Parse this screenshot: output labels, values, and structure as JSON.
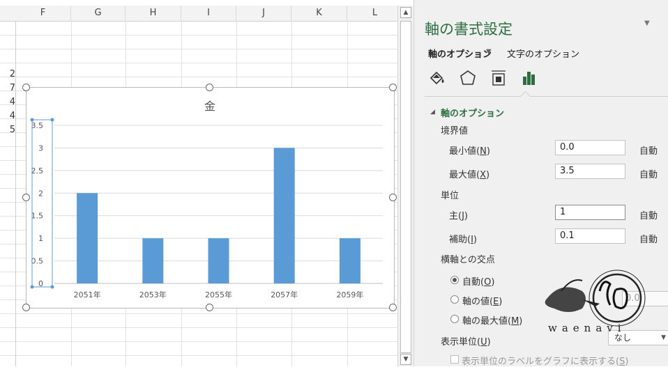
{
  "sheet": {
    "columns": [
      "F",
      "G",
      "H",
      "I",
      "J",
      "K",
      "L"
    ],
    "row_values": [
      "2",
      "7",
      "4",
      "4",
      "5"
    ]
  },
  "chart_data": {
    "type": "bar",
    "title": "金",
    "categories": [
      "2051年",
      "2053年",
      "2055年",
      "2057年",
      "2059年"
    ],
    "values": [
      2,
      1,
      1,
      3,
      1
    ],
    "yticks": [
      "0",
      "0.5",
      "1",
      "1.5",
      "2",
      "2.5",
      "3",
      "3.5"
    ],
    "ylim": [
      0,
      3.5
    ],
    "major_unit": 0.5,
    "bar_color": "#5b9bd5",
    "grid": true,
    "legend": "none"
  },
  "pane": {
    "title": "軸の書式設定",
    "tab_axis": "軸のオプション",
    "tab_text": "文字のオプション",
    "icons": [
      "fill-line-icon",
      "effects-icon",
      "size-properties-icon",
      "axis-options-icon"
    ],
    "accent": "#2c6e3f",
    "section_title": "軸のオプション",
    "bounds_label": "境界値",
    "min_label": "最小値(",
    "min_key": "N",
    "min_value": "0.0",
    "max_label": "最大値(",
    "max_key": "X",
    "max_value": "3.5",
    "units_label": "単位",
    "major_label": "主(",
    "major_key": "J",
    "major_value": "1",
    "minor_label": "補助(",
    "minor_key": "I",
    "minor_value": "0.1",
    "auto": "自動",
    "cross_label": "横軸との交点",
    "radio_auto": "自動(",
    "radio_auto_key": "O",
    "radio_value": "軸の値(",
    "radio_value_key": "E",
    "axis_value": "0.0",
    "radio_max": "軸の最大値(",
    "radio_max_key": "M",
    "display_unit_label": "表示単位(",
    "display_unit_key": "U",
    "display_unit_value": "なし",
    "show_label": "表示単位のラベルをグラフに表示する(",
    "show_label_key": "S",
    "close_paren": ")"
  },
  "watermark": {
    "text": "waenavi"
  }
}
